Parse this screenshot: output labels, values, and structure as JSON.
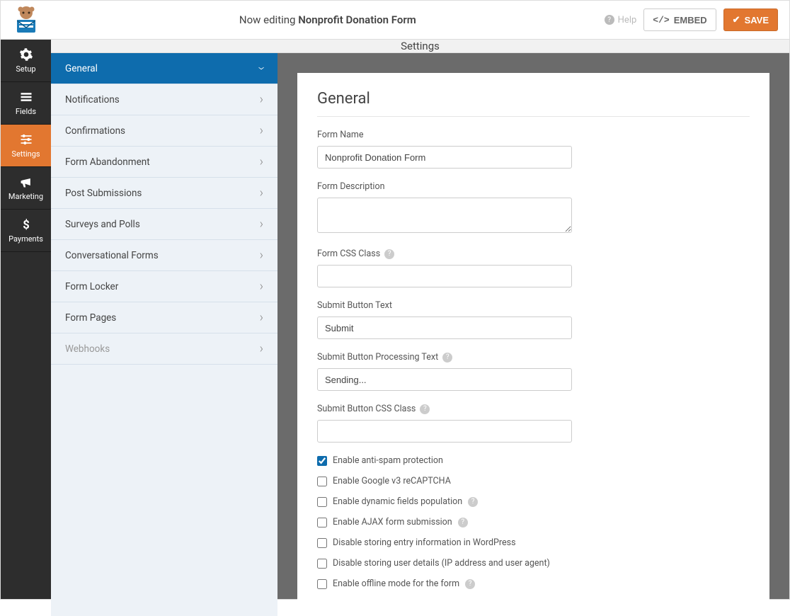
{
  "topbar": {
    "editing_prefix": "Now editing ",
    "form_title": "Nonprofit Donation Form",
    "help": "Help",
    "embed": "EMBED",
    "save": "SAVE"
  },
  "leftnav": [
    {
      "label": "Setup",
      "icon": "gear"
    },
    {
      "label": "Fields",
      "icon": "list"
    },
    {
      "label": "Settings",
      "icon": "sliders"
    },
    {
      "label": "Marketing",
      "icon": "megaphone"
    },
    {
      "label": "Payments",
      "icon": "dollar"
    }
  ],
  "settings_header": "Settings",
  "settings_sidebar": [
    {
      "label": "General",
      "active": true
    },
    {
      "label": "Notifications"
    },
    {
      "label": "Confirmations"
    },
    {
      "label": "Form Abandonment"
    },
    {
      "label": "Post Submissions"
    },
    {
      "label": "Surveys and Polls"
    },
    {
      "label": "Conversational Forms"
    },
    {
      "label": "Form Locker"
    },
    {
      "label": "Form Pages"
    },
    {
      "label": "Webhooks",
      "disabled": true
    }
  ],
  "panel": {
    "title": "General",
    "fields": {
      "form_name_label": "Form Name",
      "form_name_value": "Nonprofit Donation Form",
      "form_desc_label": "Form Description",
      "form_desc_value": "",
      "css_class_label": "Form CSS Class",
      "css_class_value": "",
      "submit_text_label": "Submit Button Text",
      "submit_text_value": "Submit",
      "submit_proc_label": "Submit Button Processing Text",
      "submit_proc_value": "Sending...",
      "submit_css_label": "Submit Button CSS Class",
      "submit_css_value": ""
    },
    "checks": [
      {
        "label": "Enable anti-spam protection",
        "checked": true,
        "help": false
      },
      {
        "label": "Enable Google v3 reCAPTCHA",
        "checked": false,
        "help": false
      },
      {
        "label": "Enable dynamic fields population",
        "checked": false,
        "help": true
      },
      {
        "label": "Enable AJAX form submission",
        "checked": false,
        "help": true
      },
      {
        "label": "Disable storing entry information in WordPress",
        "checked": false,
        "help": false
      },
      {
        "label": "Disable storing user details (IP address and user agent)",
        "checked": false,
        "help": false
      },
      {
        "label": "Enable offline mode for the form",
        "checked": false,
        "help": true
      }
    ]
  }
}
